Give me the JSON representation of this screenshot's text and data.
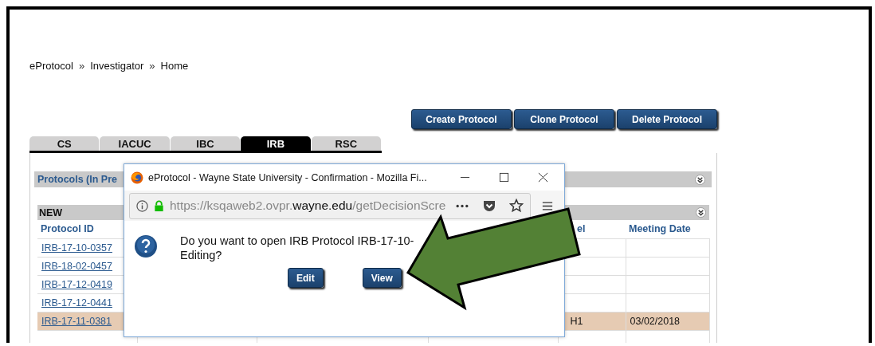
{
  "breadcrumb": [
    {
      "kind": "link",
      "label": "eProtocol"
    },
    {
      "kind": "separator",
      "label": "»"
    },
    {
      "kind": "link",
      "label": "Investigator"
    },
    {
      "kind": "separator",
      "label": "»"
    },
    {
      "kind": "link",
      "label": "Home"
    }
  ],
  "actions": [
    "Create Protocol",
    "Clone Protocol",
    "Delete Protocol"
  ],
  "tabs": [
    {
      "label": "CS",
      "selected": false
    },
    {
      "label": "IACUC",
      "selected": false
    },
    {
      "label": "IBC",
      "selected": false
    },
    {
      "label": "IRB",
      "selected": true
    },
    {
      "label": "RSC",
      "selected": false
    }
  ],
  "panel": {
    "title": "Protocols (In Pre",
    "section": {
      "title": "NEW",
      "table": {
        "columns": {
          "column_1": "Protocol ID",
          "column_5": "el",
          "column_6": "Meeting Date"
        },
        "rows": [
          {
            "column_1": "IRB-17-10-0357",
            "highlighted": false
          },
          {
            "column_1": "IRB-18-02-0457",
            "highlighted": false
          },
          {
            "column_1": "IRB-17-12-0419",
            "highlighted": false
          },
          {
            "column_1": "IRB-17-12-0441",
            "highlighted": false
          },
          {
            "column_1": "IRB-17-11-0381",
            "column_5": "H1",
            "column_6": "03/02/2018",
            "highlighted": true
          },
          {
            "highlighted": false
          }
        ]
      }
    }
  },
  "dialog": {
    "title": "eProtocol - Wayne State University - Confirmation - Mozilla Fi...",
    "url": {
      "prefix": "https://ksqaweb2.ovpr.",
      "domain": "wayne.edu",
      "path": "/getDecisionScre"
    },
    "message_lines": [
      "Do you want to open IRB Protocol IRB-17-10-",
      "Editing?"
    ],
    "buttons": [
      "Edit",
      "View"
    ]
  }
}
